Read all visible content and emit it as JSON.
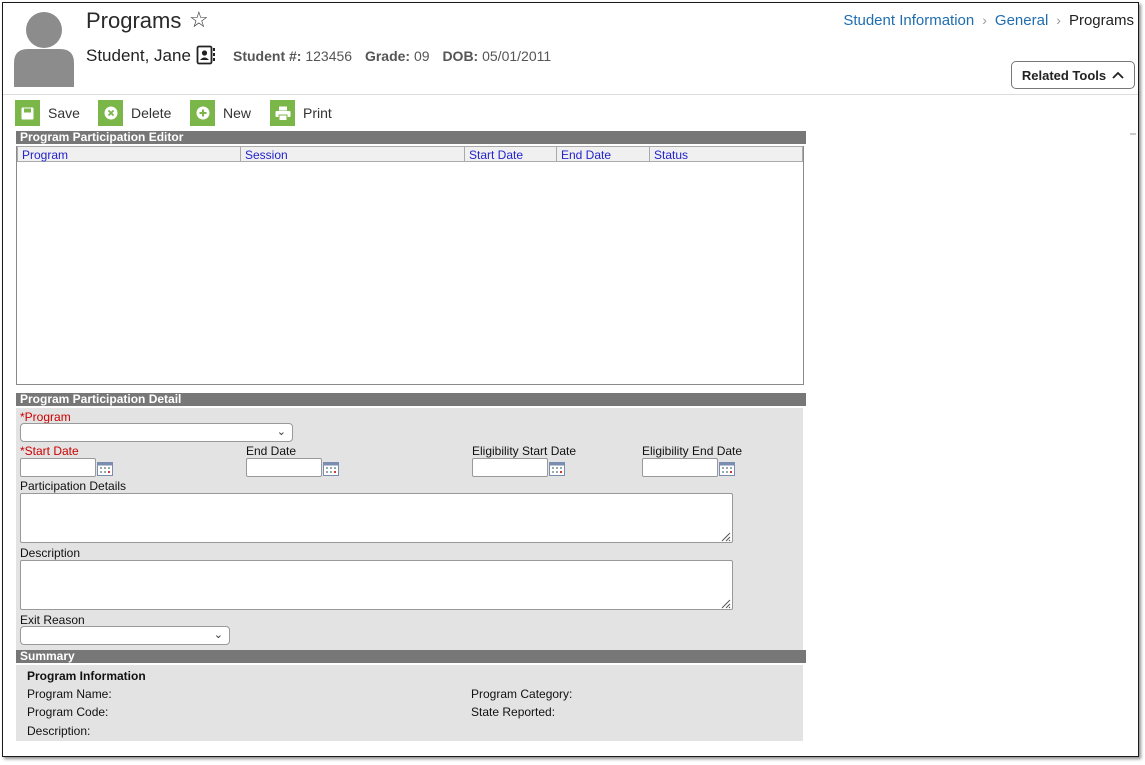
{
  "header": {
    "title": "Programs",
    "breadcrumb": [
      "Student Information",
      "General",
      "Programs"
    ],
    "student_name": "Student, Jane",
    "student_num_label": "Student #:",
    "student_num": "123456",
    "grade_label": "Grade:",
    "grade": "09",
    "dob_label": "DOB:",
    "dob": "05/01/2011",
    "related_tools": "Related Tools"
  },
  "toolbar": {
    "save": "Save",
    "delete": "Delete",
    "new": "New",
    "print": "Print"
  },
  "editor": {
    "title": "Program Participation Editor",
    "columns": [
      "Program",
      "Session",
      "Start Date",
      "End Date",
      "Status"
    ],
    "rows": []
  },
  "detail": {
    "title": "Program Participation Detail",
    "program_label": "*Program",
    "program_value": "",
    "start_date_label": "*Start Date",
    "start_date_value": "",
    "end_date_label": "End Date",
    "end_date_value": "",
    "elig_start_label": "Eligibility Start Date",
    "elig_start_value": "",
    "elig_end_label": "Eligibility End Date",
    "elig_end_value": "",
    "participation_label": "Participation Details",
    "participation_value": "",
    "description_label": "Description",
    "description_value": "",
    "exit_reason_label": "Exit Reason",
    "exit_reason_value": ""
  },
  "summary": {
    "title": "Summary",
    "section": "Program Information",
    "program_name": "Program Name:",
    "program_code": "Program Code:",
    "description": "Description:",
    "program_category": "Program Category:",
    "state_reported": "State Reported:"
  },
  "colors": {
    "accent_green": "#7ab648",
    "link_blue": "#1f6db0",
    "header_gray": "#777777",
    "panel_gray": "#e3e3e3",
    "required_red": "#cc0000",
    "column_blue": "#2222cc"
  },
  "icons": [
    "avatar-icon",
    "star-icon",
    "contact-card-icon",
    "chevron-up-icon",
    "save-icon",
    "delete-icon",
    "add-icon",
    "print-icon",
    "calendar-icon",
    "chevron-down-icon",
    "resize-grip-icon"
  ]
}
